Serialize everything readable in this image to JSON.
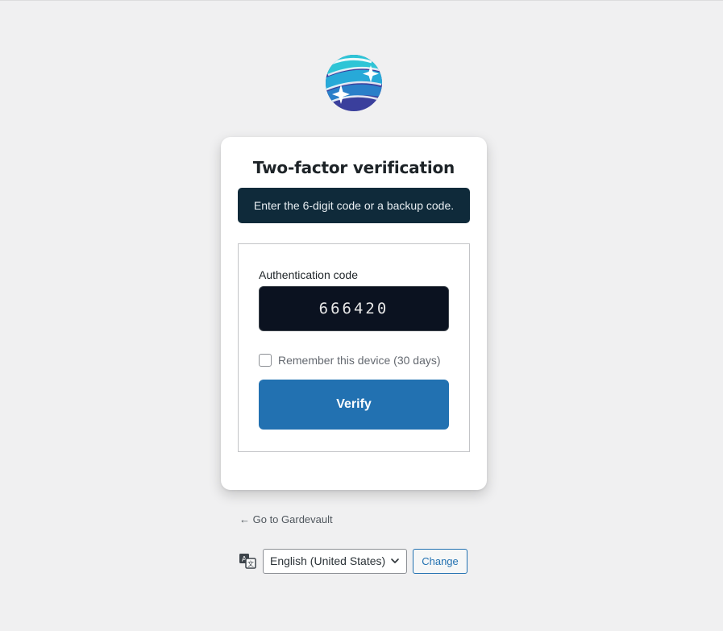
{
  "logo": {
    "icon": "globe-sparkle-logo",
    "colors": [
      "#2ec5d6",
      "#2a7fc9",
      "#3a3f9c"
    ]
  },
  "card": {
    "title": "Two-factor verification",
    "notice": "Enter the 6-digit code or a backup code.",
    "form": {
      "code_label": "Authentication code",
      "code_value": "666420",
      "remember_label": "Remember this device (30 days)",
      "remember_checked": false,
      "verify_label": "Verify"
    }
  },
  "back_link": "← Go to Gardevault",
  "language": {
    "icon": "translate-icon",
    "selected": "English (United States)",
    "change_label": "Change"
  },
  "colors": {
    "accent": "#2271b1",
    "notice_bg": "#0f2a3a",
    "input_bg": "#0b1220",
    "page_bg": "#f0f0f1"
  }
}
